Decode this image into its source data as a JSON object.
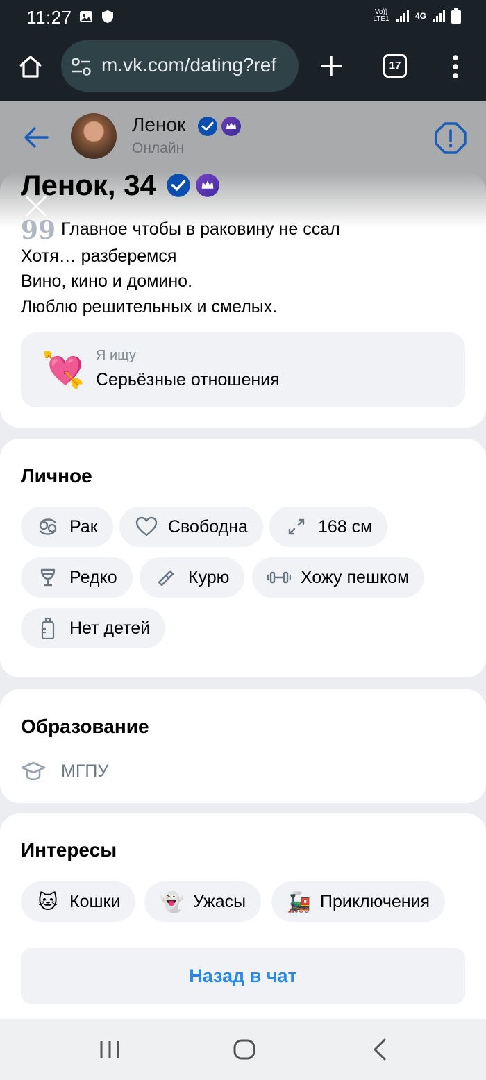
{
  "status_bar": {
    "time": "11:27",
    "net1": "Vo)) LTE1",
    "net2": "4G"
  },
  "browser": {
    "url": "m.vk.com/dating?ref",
    "tab_count": "17"
  },
  "header": {
    "name": "Ленок",
    "status": "Онлайн"
  },
  "profile": {
    "title": "Ленок, 34",
    "bio_lines": [
      "Главное чтобы в раковину не ссал",
      "Хотя… разберемся",
      "Вино, кино и домино.",
      "Люблю решительных и смелых."
    ],
    "looking_for_label": "Я ищу",
    "looking_for_value": "Серьёзные отношения"
  },
  "personal": {
    "title": "Личное",
    "chips": [
      {
        "icon": "cancer-zodiac-icon",
        "label": "Рак"
      },
      {
        "icon": "heart-icon",
        "label": "Свободна"
      },
      {
        "icon": "height-arrows-icon",
        "label": "168 см"
      },
      {
        "icon": "wine-glass-icon",
        "label": "Редко"
      },
      {
        "icon": "cigarette-icon",
        "label": "Курю"
      },
      {
        "icon": "dumbbell-icon",
        "label": "Хожу пешком"
      },
      {
        "icon": "baby-bottle-icon",
        "label": "Нет детей"
      }
    ]
  },
  "education": {
    "title": "Образование",
    "value": "МГПУ"
  },
  "interests": {
    "title": "Интересы",
    "chips": [
      {
        "emoji": "🐱",
        "label": "Кошки"
      },
      {
        "emoji": "👻",
        "label": "Ужасы"
      },
      {
        "emoji": "🚂",
        "label": "Приключения"
      }
    ]
  },
  "actions": {
    "back_to_chat": "Назад в чат"
  },
  "colors": {
    "accent": "#2688eb",
    "verified": "#0a5bd6",
    "chip_bg": "#f0f2f5",
    "browser_bg": "#1b2227"
  }
}
